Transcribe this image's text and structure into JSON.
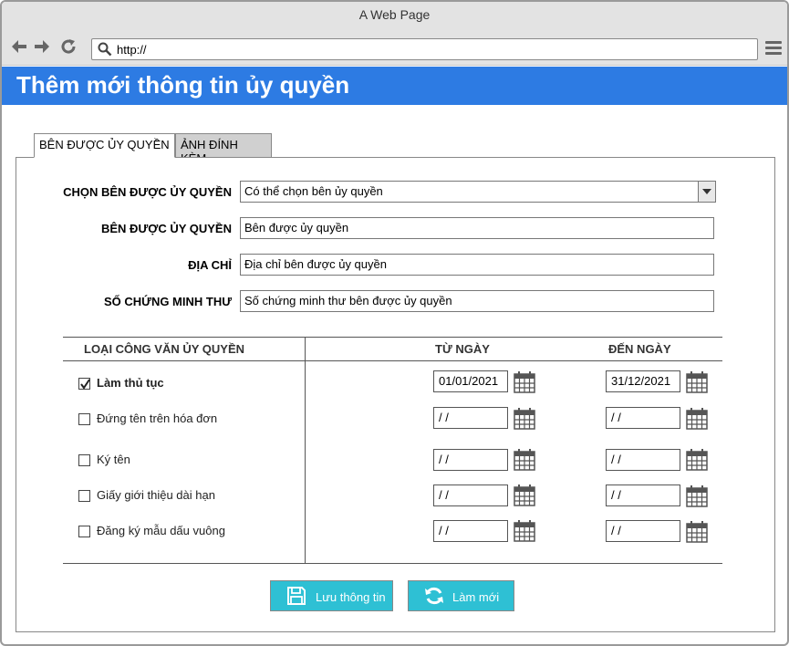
{
  "browser": {
    "window_title": "A Web Page",
    "url": "http://"
  },
  "header": {
    "title": "Thêm mới thông tin ủy quyền"
  },
  "tabs": [
    {
      "label": "BÊN ĐƯỢC ỦY QUYỀN",
      "active": true
    },
    {
      "label": "ẢNH ĐÍNH KÈM",
      "active": false
    }
  ],
  "form": {
    "select_label": "CHỌN BÊN ĐƯỢC ỦY QUYỀN",
    "select_value": "Có thể chọn bên ủy quyền",
    "name_label": "BÊN ĐƯỢC ỦY QUYỀN",
    "name_value": "Bên được ủy quyền",
    "address_label": "ĐỊA CHỈ",
    "address_value": "Địa chỉ bên được ủy quyền",
    "id_label": "SỐ CHỨNG MINH THƯ",
    "id_value": "Số chứng minh thư bên được ủy quyền"
  },
  "table": {
    "col_type": "LOẠI CÔNG VĂN ỦY QUYỀN",
    "col_from": "TỪ NGÀY",
    "col_to": "ĐẾN NGÀY",
    "rows": [
      {
        "label": "Làm thủ tục",
        "checked": true,
        "from": "01/01/2021",
        "to": "31/12/2021"
      },
      {
        "label": "Đứng tên trên hóa đơn",
        "checked": false,
        "from": " /  /",
        "to": " /  /"
      },
      {
        "label": "Ký tên",
        "checked": false,
        "from": " /  /",
        "to": " /  /"
      },
      {
        "label": "Giấy giới thiệu dài hạn",
        "checked": false,
        "from": " /  /",
        "to": " /  /"
      },
      {
        "label": "Đăng ký mẫu dấu vuông",
        "checked": false,
        "from": " /  /",
        "to": " /  /"
      }
    ]
  },
  "actions": {
    "save_label": "Lưu thông tin",
    "reset_label": "Làm mới"
  },
  "colors": {
    "header_bg": "#2d7be3",
    "button_bg": "#2ec0d4"
  },
  "icons": [
    "back-arrow-icon",
    "forward-arrow-icon",
    "refresh-icon",
    "search-icon",
    "menu-icon",
    "calendar-icon",
    "save-icon",
    "refresh-icon"
  ]
}
